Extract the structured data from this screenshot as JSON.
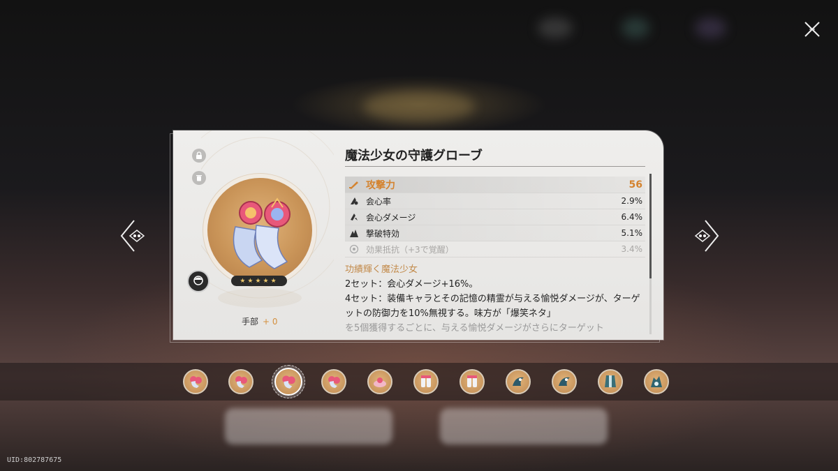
{
  "relic": {
    "name": "魔法少女の守護グローブ",
    "slot": "手部",
    "level": "+ 0",
    "rarity_stars": "★★★★★",
    "main_stat": {
      "label": "攻撃力",
      "value": "56",
      "icon": "sword-icon"
    },
    "sub_stats": [
      {
        "label": "会心率",
        "value": "2.9%",
        "icon": "crit-rate-icon"
      },
      {
        "label": "会心ダメージ",
        "value": "6.4%",
        "icon": "crit-dmg-icon"
      },
      {
        "label": "撃破特効",
        "value": "5.1%",
        "icon": "break-effect-icon"
      },
      {
        "label": "効果抵抗（+3で覚醒）",
        "value": "3.4%",
        "icon": "effect-res-icon"
      }
    ],
    "set": {
      "name": "功績輝く魔法少女",
      "bonus_2": "2セット：会心ダメージ+16%。",
      "bonus_4": "4セット：装備キャラとその記憶の精霊が与える愉悦ダメージが、ターゲットの防御力を10%無視する。味方が「爆笑ネタ」",
      "bonus_4_cont": "を5個獲得するごとに、与える愉悦ダメージがさらにターゲット"
    }
  },
  "uid": "UID:802787675",
  "colors": {
    "accent": "#d4832f",
    "set_name": "#c28a4a",
    "card_bg": "#efeeec"
  }
}
